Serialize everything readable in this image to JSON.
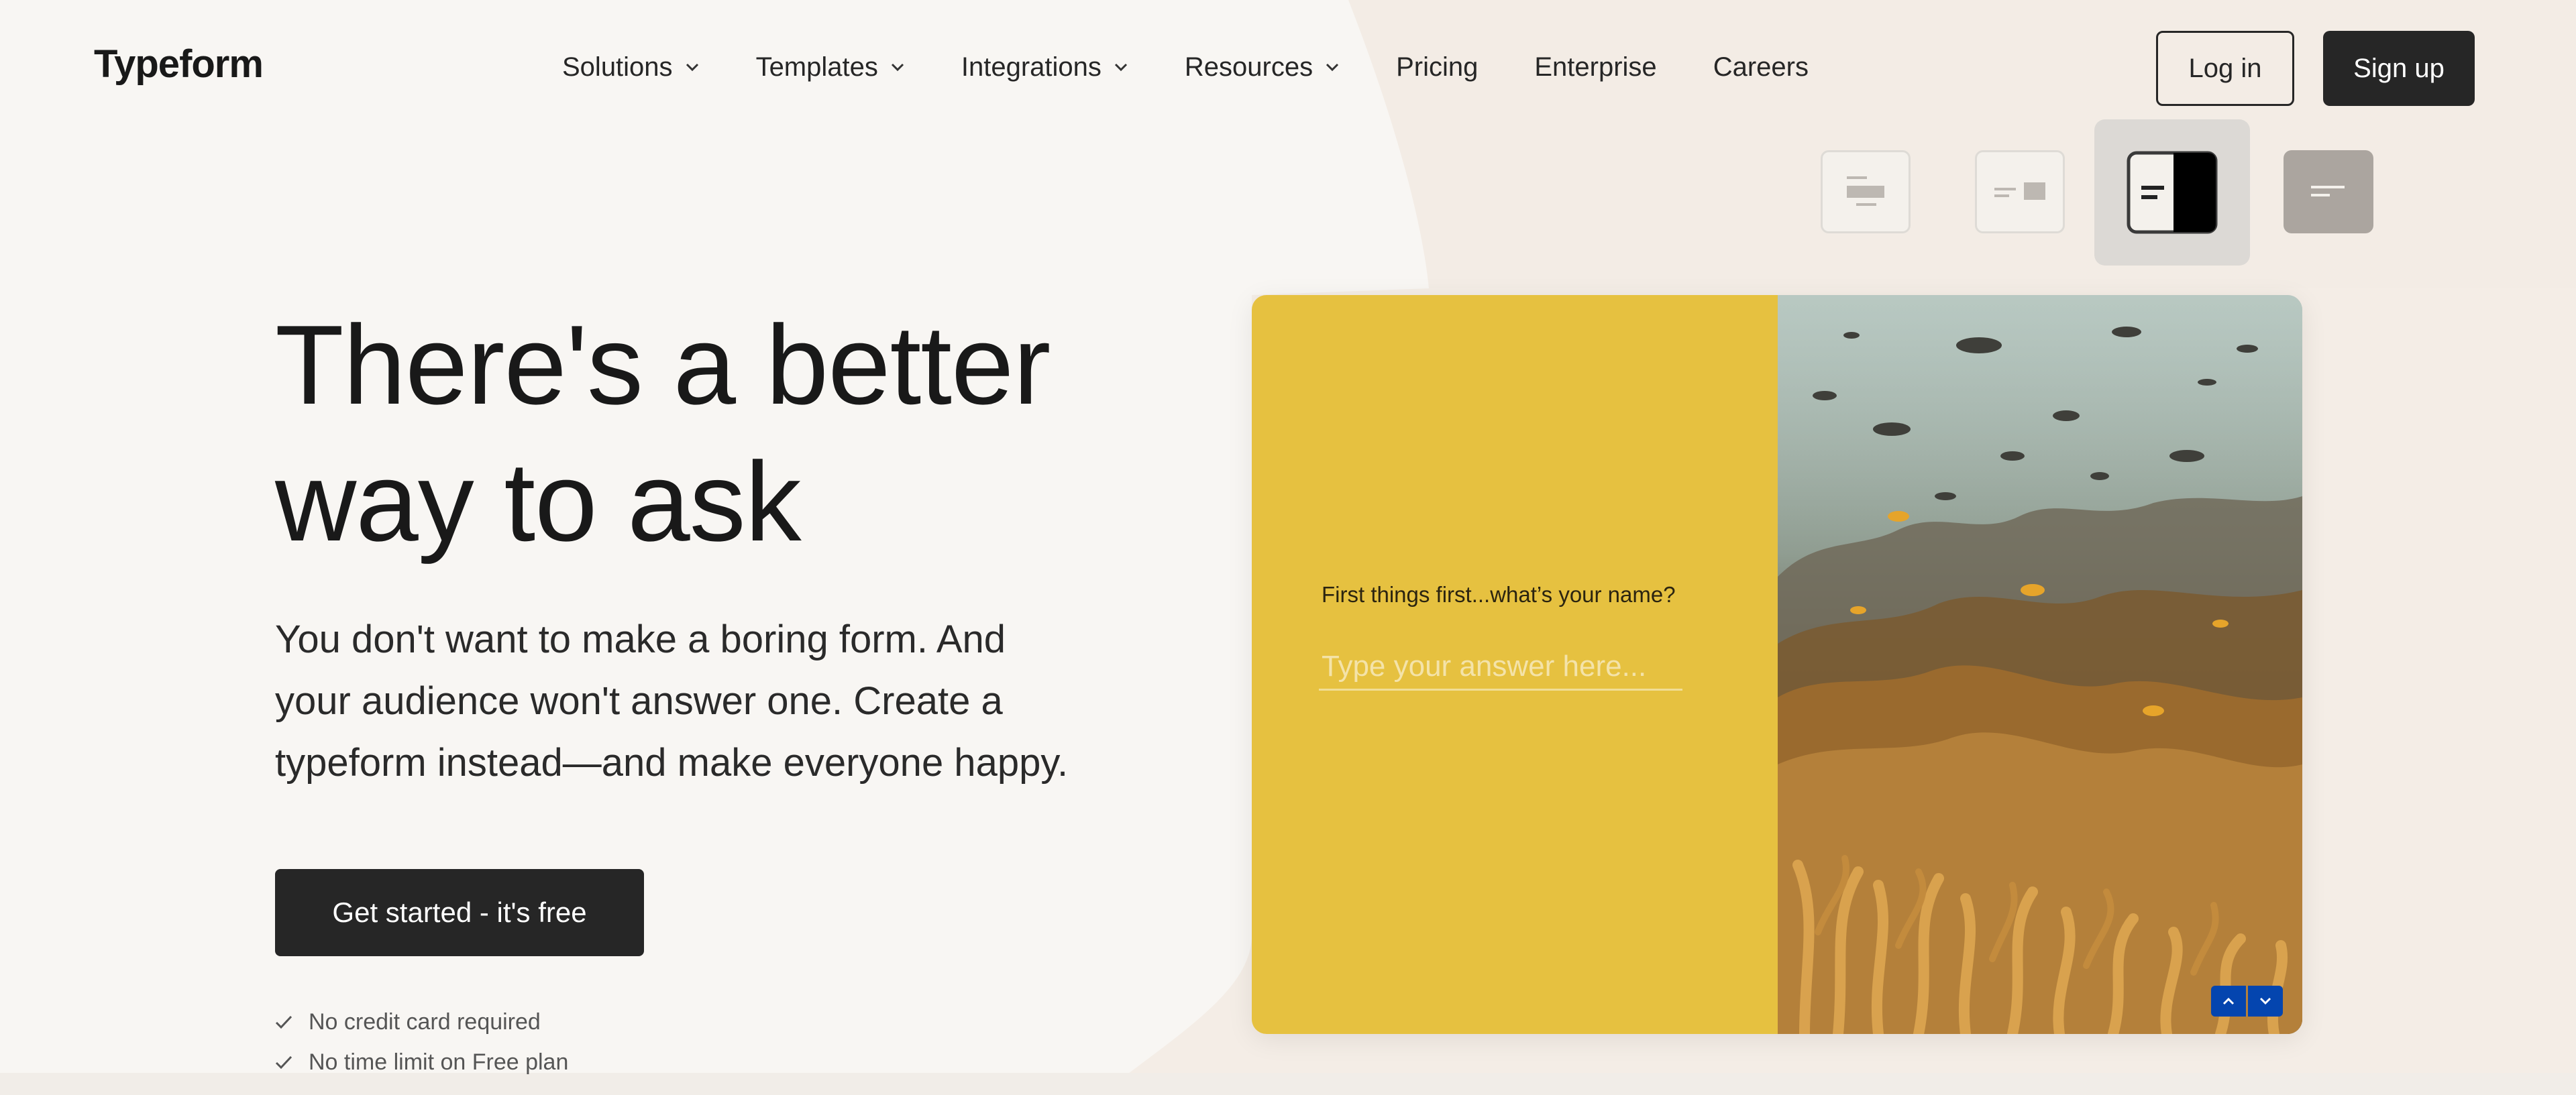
{
  "header": {
    "logo": "Typeform",
    "nav": [
      {
        "label": "Solutions",
        "dropdown": true
      },
      {
        "label": "Templates",
        "dropdown": true
      },
      {
        "label": "Integrations",
        "dropdown": true
      },
      {
        "label": "Resources",
        "dropdown": true
      },
      {
        "label": "Pricing",
        "dropdown": false
      },
      {
        "label": "Enterprise",
        "dropdown": false
      },
      {
        "label": "Careers",
        "dropdown": false
      }
    ],
    "login_label": "Log in",
    "signup_label": "Sign up"
  },
  "layout_switcher": {
    "options": [
      "stack-layout-icon",
      "float-layout-icon",
      "split-layout-icon",
      "wallpaper-layout-icon"
    ],
    "selected_index": 2
  },
  "hero": {
    "headline_line1": "There's a better",
    "headline_line2": "way to ask",
    "subtext_line1": "You don't want to make a boring form. And",
    "subtext_line2": "your audience won't answer one. Create a",
    "subtext_line3": "typeform instead—and make everyone happy.",
    "cta_label": "Get started - it's free",
    "checks": [
      "No credit card required",
      "No time limit on Free plan"
    ]
  },
  "form_preview": {
    "question": "First things first...what’s your name?",
    "answer_placeholder": "Type your answer here...",
    "panel_color": "#e6c140",
    "nav_color": "#0445af"
  },
  "colors": {
    "page_bg": "#f8f6f3",
    "accent_dark": "#262626"
  }
}
